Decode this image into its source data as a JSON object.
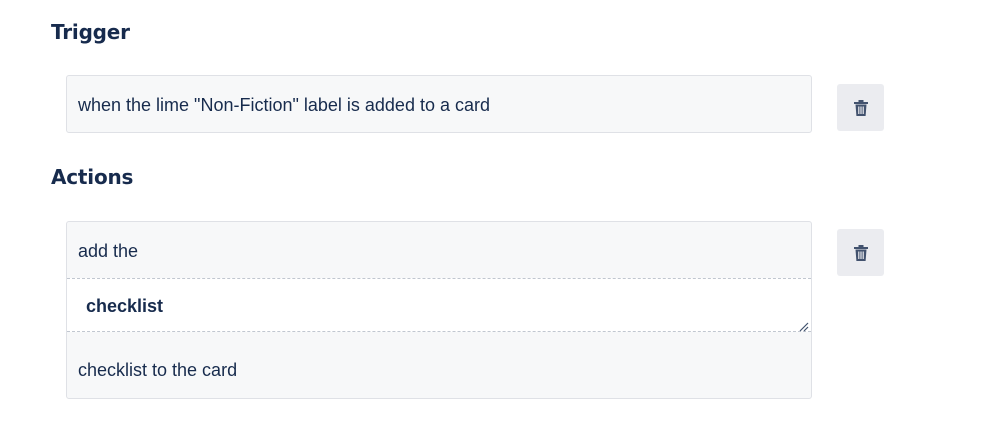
{
  "trigger": {
    "title": "Trigger",
    "text": "when the lime \"Non-Fiction\" label is added to a card",
    "delete_icon": "trash-icon"
  },
  "actions": {
    "title": "Actions",
    "items": [
      {
        "prefix": "add the",
        "checklist_value": "checklist",
        "suffix": "checklist to the card",
        "delete_icon": "trash-icon"
      }
    ]
  },
  "colors": {
    "text": "#172b4d",
    "box_background": "#f7f8f9",
    "box_border": "#dfe1e6",
    "button_background": "#ebecf0",
    "icon": "#42526e"
  }
}
